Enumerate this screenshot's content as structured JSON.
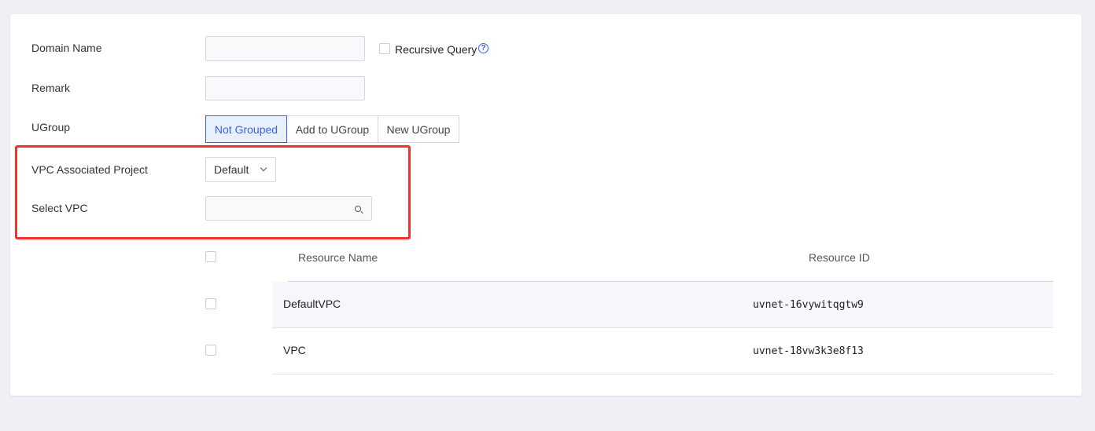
{
  "form": {
    "domain_name_label": "Domain Name",
    "domain_name_value": "",
    "recursive_query_label": "Recursive Query",
    "recursive_query_checked": false,
    "help_icon": "question-circle-icon",
    "remark_label": "Remark",
    "remark_value": "",
    "ugroup_label": "UGroup",
    "ugroup_options": [
      "Not Grouped",
      "Add to UGroup",
      "New UGroup"
    ],
    "ugroup_selected": "Not Grouped",
    "vpc_project_label": "VPC Associated Project",
    "vpc_project_value": "Default",
    "select_vpc_label": "Select VPC",
    "select_vpc_value": ""
  },
  "table": {
    "headers": [
      "Resource Name",
      "Resource ID"
    ],
    "rows": [
      {
        "name": "DefaultVPC",
        "id": "uvnet-16vywitqgtw9"
      },
      {
        "name": "VPC",
        "id": "uvnet-18vw3k3e8f13"
      }
    ]
  },
  "colors": {
    "accent": "#3860f4",
    "highlight": "#f2312a",
    "background": "#eef0f6"
  }
}
